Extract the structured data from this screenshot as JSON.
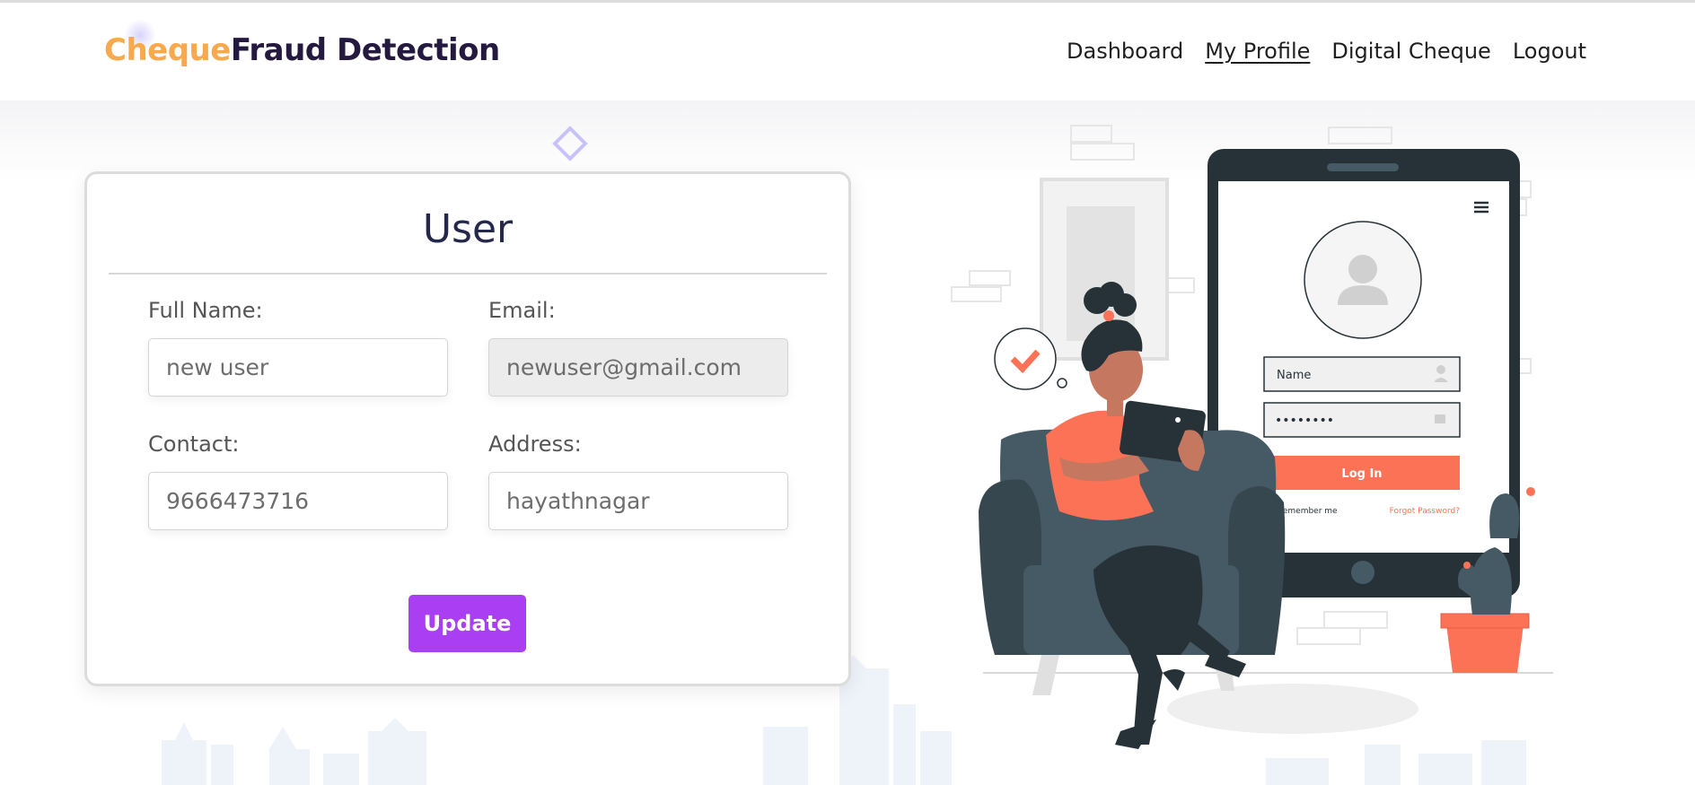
{
  "brand": {
    "part1": "Cheque",
    "part2": "Fraud Detection"
  },
  "nav": {
    "items": [
      {
        "label": "Dashboard"
      },
      {
        "label": "My Profile"
      },
      {
        "label": "Digital Cheque"
      },
      {
        "label": "Logout"
      }
    ],
    "active": "My Profile"
  },
  "profile_card": {
    "title": "User",
    "fields": {
      "full_name": {
        "label": "Full Name:",
        "value": "new user"
      },
      "email": {
        "label": "Email:",
        "value": "newuser@gmail.com"
      },
      "contact": {
        "label": "Contact:",
        "value": "9666473716"
      },
      "address": {
        "label": "Address:",
        "value": "hayathnagar"
      }
    },
    "update_label": "Update"
  },
  "illustration": {
    "phone_name_placeholder": "Name",
    "phone_password_mask": "••••••••",
    "phone_login_label": "Log In",
    "phone_remember_label": "Remember me",
    "phone_forgot_label": "Forgot Password?"
  },
  "colors": {
    "brand_orange": "#f8a94e",
    "brand_dark": "#24193f",
    "button_purple": "#a93ef3",
    "illustration_coral": "#fb7256",
    "illustration_dark": "#263238"
  }
}
